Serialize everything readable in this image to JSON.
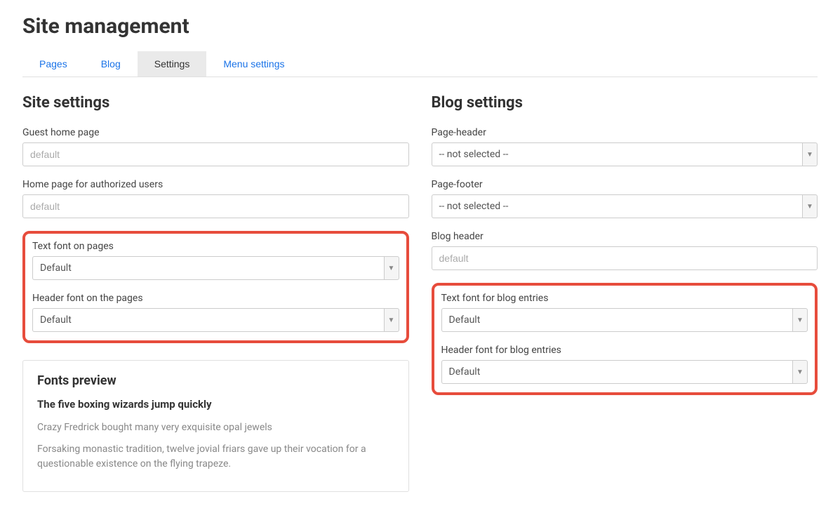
{
  "page_title": "Site management",
  "tabs": {
    "pages": "Pages",
    "blog": "Blog",
    "settings": "Settings",
    "menu_settings": "Menu settings"
  },
  "site_settings": {
    "heading": "Site settings",
    "guest_home": {
      "label": "Guest home page",
      "placeholder": "default"
    },
    "auth_home": {
      "label": "Home page for authorized users",
      "placeholder": "default"
    },
    "text_font": {
      "label": "Text font on pages",
      "value": "Default"
    },
    "header_font": {
      "label": "Header font on the pages",
      "value": "Default"
    }
  },
  "blog_settings": {
    "heading": "Blog settings",
    "page_header": {
      "label": "Page-header",
      "value": "-- not selected --"
    },
    "page_footer": {
      "label": "Page-footer",
      "value": "-- not selected --"
    },
    "blog_header": {
      "label": "Blog header",
      "placeholder": "default"
    },
    "text_font": {
      "label": "Text font for blog entries",
      "value": "Default"
    },
    "header_font": {
      "label": "Header font for blog entries",
      "value": "Default"
    }
  },
  "fonts_preview": {
    "title": "Fonts preview",
    "bold_line": "The five boxing wizards jump quickly",
    "line1": "Crazy Fredrick bought many very exquisite opal jewels",
    "line2": "Forsaking monastic tradition, twelve jovial friars gave up their vocation for a questionable existence on the flying trapeze."
  }
}
